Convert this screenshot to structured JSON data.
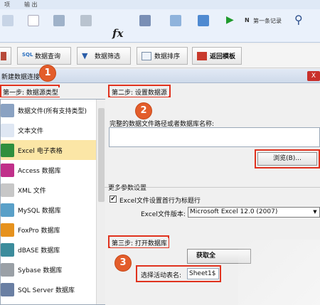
{
  "ribbon": {
    "menu": [
      "项",
      "输 出"
    ],
    "fx": "fx",
    "first_record": "第一条记录",
    "nav_prev": "N"
  },
  "tabs": [
    {
      "label": "",
      "icon": "partial-icon"
    },
    {
      "label": "数据查询",
      "icon": "sql-icon"
    },
    {
      "label": "数据筛选",
      "icon": "filter-icon"
    },
    {
      "label": "数据排序",
      "icon": "sort-icon"
    },
    {
      "label": "返回模板",
      "icon": "back-template-icon"
    }
  ],
  "dialog": {
    "title": "新建数据连接",
    "close": "X",
    "step1_label": "第一步: 数据源类型",
    "step2_label": "第二步: 设置数据源",
    "step3_label": "第三步: 打开数据库",
    "path_prompt": "完整的数据文件路径或者数据库名称:",
    "browse_label": "浏览(B)...",
    "more_params": "更多参数设置",
    "header_row_checkbox_label": "Excel文件设置首行为标题行",
    "header_row_checked": "✔",
    "version_label": "Excel文件版本:",
    "version_value": "Microsoft Excel 12.0 (2007)",
    "get_all_label": "获取全",
    "active_sheet_label": "选择活动表名:",
    "active_sheet_value": "Sheet1$"
  },
  "badges": [
    "1",
    "2",
    "3"
  ],
  "datasources": [
    {
      "label": "数据文件(所有支持类型)",
      "icon": "multi-file-icon",
      "color": "#8aa2c2",
      "selected": false
    },
    {
      "label": "文本文件",
      "icon": "text-file-icon",
      "color": "#dfe7f3",
      "selected": false
    },
    {
      "label": "Excel 电子表格",
      "icon": "excel-icon",
      "color": "#2f8f3d",
      "selected": true
    },
    {
      "label": "Access 数据库",
      "icon": "access-key-icon",
      "color": "#c0308a",
      "selected": false
    },
    {
      "label": "XML 文件",
      "icon": "xml-file-icon",
      "color": "#c7c7c7",
      "selected": false
    },
    {
      "label": "MySQL 数据库",
      "icon": "mysql-icon",
      "color": "#5aa0c8",
      "selected": false
    },
    {
      "label": "FoxPro 数据库",
      "icon": "foxpro-icon",
      "color": "#e6921e",
      "selected": false
    },
    {
      "label": "dBASE 数据库",
      "icon": "dbase-icon",
      "color": "#3c8c9c",
      "selected": false
    },
    {
      "label": "Sybase 数据库",
      "icon": "sybase-icon",
      "color": "#9aa0a6",
      "selected": false
    },
    {
      "label": "SQL Server 数据库",
      "icon": "sqlserver-icon",
      "color": "#6a7fa3",
      "selected": false
    }
  ],
  "colors": {
    "highlight": "#e0321e",
    "badge": "#e35d2b",
    "selected": "#fbe6a6"
  }
}
